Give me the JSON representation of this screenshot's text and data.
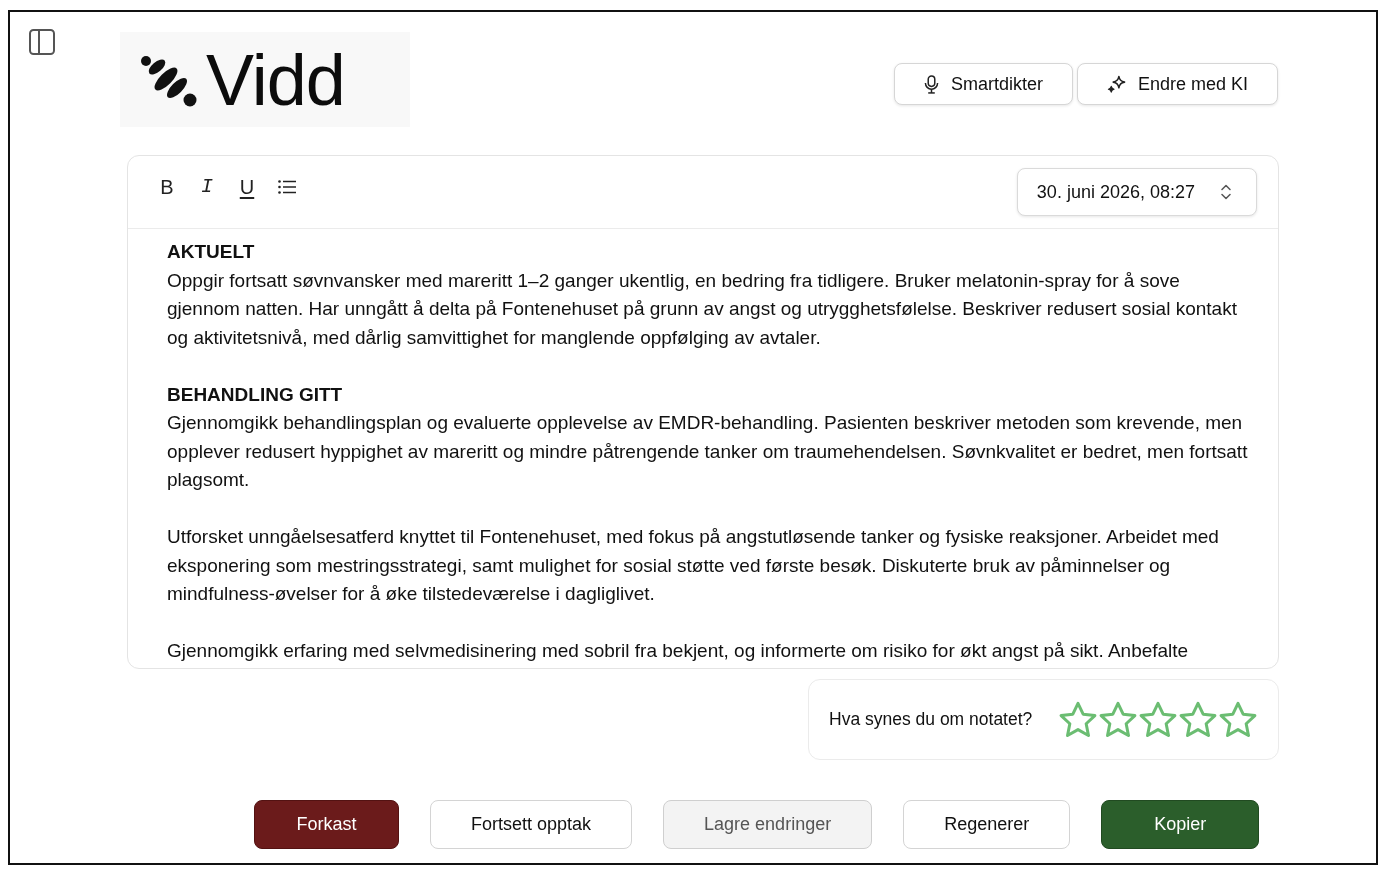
{
  "logo": {
    "text": "Vidd"
  },
  "header_buttons": [
    {
      "label": "Smartdikter",
      "kind": "dictation"
    },
    {
      "label": "Endre med KI",
      "kind": "ai"
    }
  ],
  "editor": {
    "toolbar": [
      {
        "kind": "bold",
        "label": "B"
      },
      {
        "kind": "italic",
        "label": "I"
      },
      {
        "kind": "underline",
        "label": "U"
      },
      {
        "kind": "list"
      }
    ],
    "date": {
      "value": "30. juni 2026, 08:27"
    },
    "sections": [
      {
        "heading": "AKTUELT",
        "paragraphs": [
          "Oppgir fortsatt søvnvansker med mareritt 1–2 ganger ukentlig, en bedring fra tidligere. Bruker melatonin-spray for å sove gjennom natten. Har unngått å delta på Fontenehuset på grunn av angst og utrygghetsfølelse. Beskriver redusert sosial kontakt og aktivitetsnivå, med dårlig samvittighet for manglende oppfølging av avtaler."
        ]
      },
      {
        "heading": "BEHANDLING GITT",
        "paragraphs": [
          "Gjennomgikk behandlingsplan og evaluerte opplevelse av EMDR-behandling. Pasienten beskriver metoden som krevende, men opplever redusert hyppighet av mareritt og mindre påtrengende tanker om traumehendelsen. Søvnkvalitet er bedret, men fortsatt plagsomt.",
          "Utforsket unngåelsesatferd knyttet til Fontenehuset, med fokus på angstutløsende tanker og fysiske reaksjoner. Arbeidet med eksponering som mestringsstrategi, samt mulighet for sosial støtte ved første besøk. Diskuterte bruk av påminnelser og mindfulness-øvelser for å øke tilstedeværelse i dagliglivet.",
          "Gjennomgikk erfaring med selvmedisinering med sobril fra bekjent, og informerte om risiko for økt angst på sikt. Anbefalte"
        ]
      }
    ]
  },
  "rating": {
    "question": "Hva synes du om notatet?",
    "stars": 0
  },
  "actions": [
    {
      "label": "Forkast",
      "kind": "danger",
      "disabled": false
    },
    {
      "label": "Fortsett opptak",
      "kind": "secondary",
      "disabled": false
    },
    {
      "label": "Lagre endringer",
      "kind": "secondary",
      "disabled": true
    },
    {
      "label": "Regenerer",
      "kind": "secondary",
      "disabled": false
    },
    {
      "label": "Kopier",
      "kind": "primary",
      "disabled": false
    }
  ]
}
